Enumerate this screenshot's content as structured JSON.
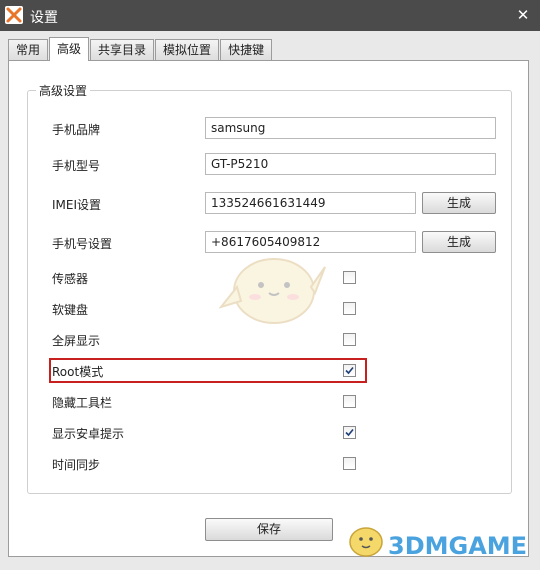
{
  "window": {
    "title": "设置",
    "close_glyph": "✕"
  },
  "tabs": [
    {
      "label": "常用",
      "active": false
    },
    {
      "label": "高级",
      "active": true
    },
    {
      "label": "共享目录",
      "active": false
    },
    {
      "label": "模拟位置",
      "active": false
    },
    {
      "label": "快捷键",
      "active": false
    }
  ],
  "group": {
    "title": "高级设置",
    "phone_brand": {
      "label": "手机品牌",
      "value": "samsung"
    },
    "phone_model": {
      "label": "手机型号",
      "value": "GT-P5210"
    },
    "imei": {
      "label": "IMEI设置",
      "value": "133524661631449",
      "button": "生成"
    },
    "phone_number": {
      "label": "手机号设置",
      "value": "+8617605409812",
      "button": "生成"
    },
    "options": [
      {
        "label": "传感器",
        "checked": false
      },
      {
        "label": "软键盘",
        "checked": false
      },
      {
        "label": "全屏显示",
        "checked": false
      },
      {
        "label": "Root模式",
        "checked": true
      },
      {
        "label": "隐藏工具栏",
        "checked": false
      },
      {
        "label": "显示安卓提示",
        "checked": true
      },
      {
        "label": "时间同步",
        "checked": false
      }
    ]
  },
  "save_button": "保存",
  "watermark": {
    "text": "3DMGAME"
  },
  "colors": {
    "titlebar": "#4b4b4b",
    "highlight": "#c81f1f",
    "watermark": "#4aa3df"
  }
}
